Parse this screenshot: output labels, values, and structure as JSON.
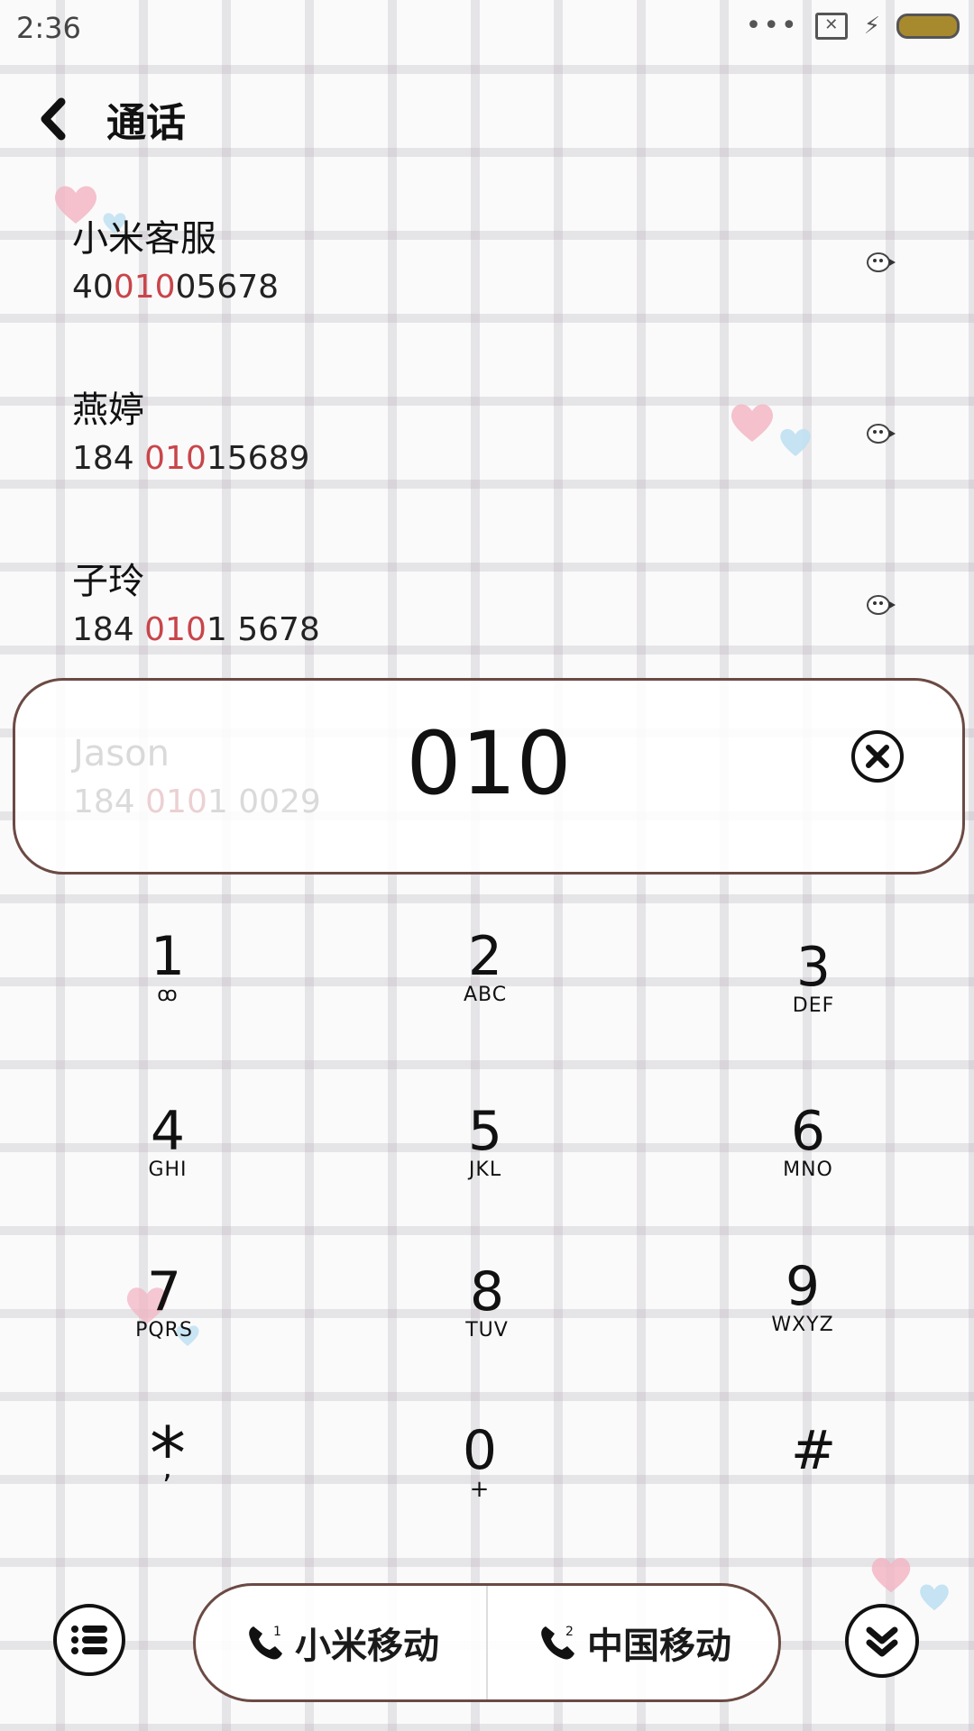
{
  "status_bar": {
    "time": "2:36",
    "more": "•••"
  },
  "header": {
    "title": "通话"
  },
  "results": [
    {
      "name": "小米客服",
      "number_pre": "40",
      "number_hl": "010",
      "number_post": "05678"
    },
    {
      "name": "燕婷",
      "number_pre": "184 ",
      "number_hl": "010",
      "number_post": "15689"
    },
    {
      "name": "子玲",
      "number_pre": "184 ",
      "number_hl": "010",
      "number_post": "1 5678"
    },
    {
      "name": "Jason",
      "number_pre": "184 ",
      "number_hl": "010",
      "number_post": "1 0029"
    }
  ],
  "dialer": {
    "input": "010"
  },
  "keys": [
    {
      "digit": "1",
      "letters": "ꝏ"
    },
    {
      "digit": "2",
      "letters": "ABC"
    },
    {
      "digit": "3",
      "letters": "DEF"
    },
    {
      "digit": "4",
      "letters": "GHI"
    },
    {
      "digit": "5",
      "letters": "JKL"
    },
    {
      "digit": "6",
      "letters": "MNO"
    },
    {
      "digit": "7",
      "letters": "PQRS"
    },
    {
      "digit": "8",
      "letters": "TUV"
    },
    {
      "digit": "9",
      "letters": "WXYZ"
    },
    {
      "digit": "*",
      "letters": ","
    },
    {
      "digit": "0",
      "letters": "+"
    },
    {
      "digit": "#",
      "letters": ""
    }
  ],
  "call_bar": {
    "sim1": {
      "label": "小米移动",
      "slot": "1"
    },
    "sim2": {
      "label": "中国移动",
      "slot": "2"
    }
  },
  "icons": {
    "back": "back-arrow-icon",
    "clear": "clear-icon",
    "menu": "menu-list-icon",
    "collapse": "collapse-keypad-icon",
    "phone": "phone-icon"
  },
  "colors": {
    "highlight": "#c8454a",
    "border": "#6b4a44",
    "battery": "#a88a2e"
  }
}
